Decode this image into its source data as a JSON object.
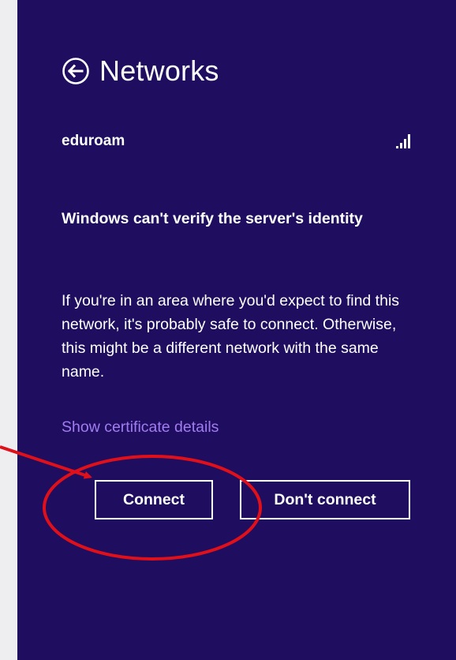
{
  "header": {
    "title": "Networks",
    "back_icon": "back-arrow-circle-icon"
  },
  "network": {
    "name": "eduroam",
    "signal_icon": "wifi-signal-bars-icon",
    "signal_bars": 4
  },
  "dialog": {
    "heading": "Windows can't verify the server's identity",
    "body": "If you're in an area where you'd expect to find this network, it's probably safe to connect. Otherwise, this might be a different network with the same name.",
    "cert_link": "Show certificate details"
  },
  "buttons": {
    "connect": "Connect",
    "dont_connect": "Don't connect"
  },
  "colors": {
    "panel_bg": "#1f0e5f",
    "link": "#a07cf0",
    "annotation": "#e0101a",
    "page_bg": "#eeeef1"
  }
}
